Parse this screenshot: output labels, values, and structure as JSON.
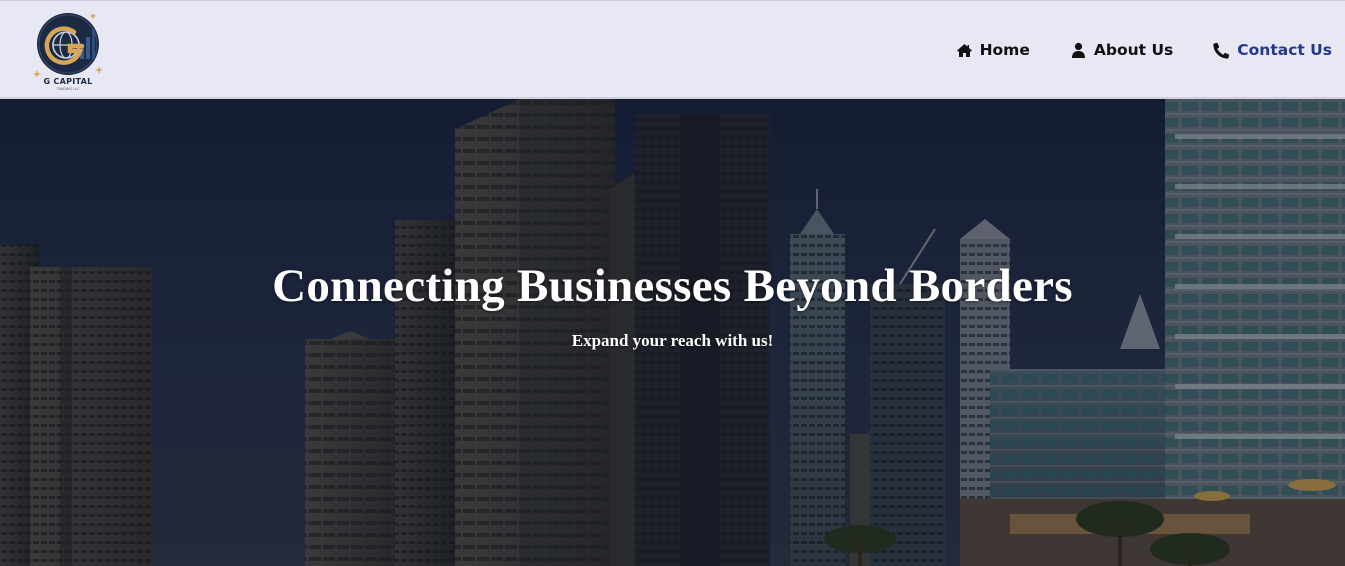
{
  "brand": {
    "name": "G CAPITAL",
    "tagline": "TRADING LLC"
  },
  "nav": {
    "items": [
      {
        "label": "Home",
        "icon": "home-icon",
        "active": false
      },
      {
        "label": "About Us",
        "icon": "user-icon",
        "active": false
      },
      {
        "label": "Contact Us",
        "icon": "phone-icon",
        "active": true
      }
    ]
  },
  "hero": {
    "title": "Connecting Businesses Beyond Borders",
    "subtitle": "Expand your reach with us!"
  },
  "colors": {
    "navbar_bg": "#e7e8f4",
    "nav_text": "#111111",
    "nav_active": "#23388a",
    "logo_gold": "#d7a657",
    "logo_navy": "#1d2a44"
  }
}
